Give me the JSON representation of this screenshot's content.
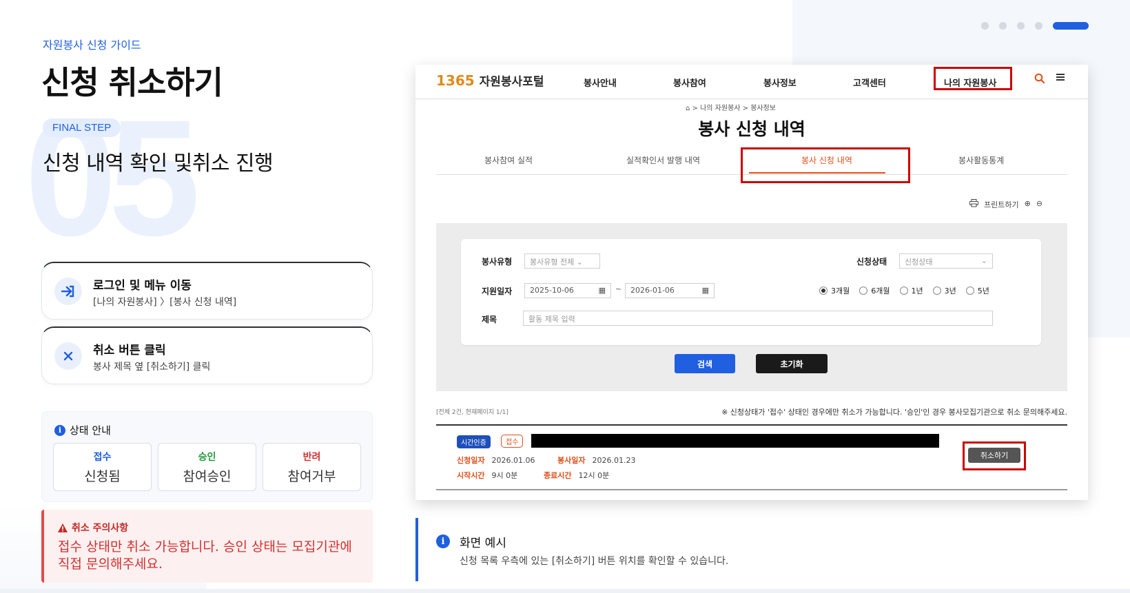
{
  "header": {
    "eyebrow": "자원봉사 신청 가이드",
    "title": "신청 취소하기",
    "step_number": "05",
    "step_pill": "FINAL STEP",
    "subtitle": "신청 내역 확인 및취소 진행"
  },
  "pagination": {
    "total": 5,
    "active_index": 4
  },
  "steps": [
    {
      "title": "로그인 및 메뉴 이동",
      "desc": "[나의 자원봉사] 〉[봉사 신청 내역]",
      "icon": "login-icon"
    },
    {
      "title": "취소 버튼 클릭",
      "desc": "봉사 제목 옆 [취소하기] 클릭",
      "icon": "close-icon"
    }
  ],
  "status_guide": {
    "heading": "상태 안내",
    "items": [
      {
        "label": "접수",
        "desc": "신청됨",
        "color": "#1f5fe0"
      },
      {
        "label": "승인",
        "desc": "참여승인",
        "color": "#1e9a3a"
      },
      {
        "label": "반려",
        "desc": "참여거부",
        "color": "#d32f2f"
      }
    ]
  },
  "warning": {
    "heading": "취소 주의사항",
    "text": "접수 상태만 취소 가능합니다. 승인 상태는 모집기관에 직접 문의해주세요."
  },
  "screenshot": {
    "logo_num": "1365",
    "logo_text": "자원봉사포털",
    "nav": [
      "봉사안내",
      "봉사참여",
      "봉사정보",
      "고객센터",
      "나의 자원봉사"
    ],
    "breadcrumb": "⌂ > 나의 자원봉사 > 봉사정보",
    "page_title": "봉사 신청 내역",
    "tabs": [
      "봉사참여 실적",
      "실적확인서 발행 내역",
      "봉사 신청 내역",
      "봉사활동통계"
    ],
    "tools": {
      "print": "프린트하기",
      "zoom_in": "⊕",
      "zoom_out": "⊖"
    },
    "form": {
      "type_label": "봉사유형",
      "type_value": "봉사유형 전체",
      "status_label": "신청상태",
      "status_value": "신청상태",
      "date_label": "지원일자",
      "date_from": "2025-10-06",
      "date_to": "2026-01-06",
      "date_sep": "~",
      "periods": [
        "3개월",
        "6개월",
        "1년",
        "3년",
        "5년"
      ],
      "period_selected": 0,
      "title_label": "제목",
      "title_placeholder": "활동 제목 입력",
      "search_btn": "검색",
      "reset_btn": "초기화"
    },
    "count_text": "[전체 2건, 현재페이지 1/1]",
    "notice": "※ 신청상태가 '접수' 상태인 경우에만 취소가 가능합니다. '승인'인 경우 봉사모집기관으로 취소 문의해주세요.",
    "row": {
      "badge_type": "시간인증",
      "badge_status": "접수",
      "apply_date_label": "신청일자",
      "apply_date": "2026.01.06",
      "service_date_label": "봉사일자",
      "service_date": "2026.01.23",
      "start_label": "시작시간",
      "start": "9시 0분",
      "end_label": "종료시간",
      "end": "12시 0분",
      "cancel_btn": "취소하기"
    }
  },
  "caption": {
    "title": "화면 예시",
    "desc": "신청 목록 우측에 있는 [취소하기] 버튼 위치를 확인할 수 있습니다."
  }
}
